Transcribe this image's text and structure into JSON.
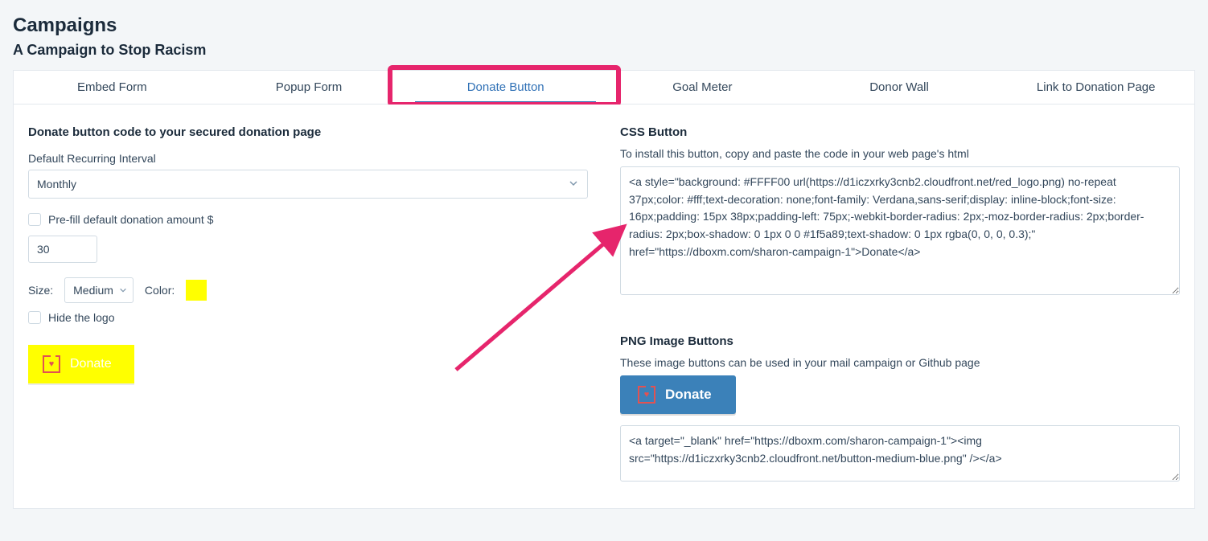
{
  "header": {
    "title": "Campaigns",
    "subtitle": "A Campaign to Stop Racism"
  },
  "tabs": [
    {
      "label": "Embed Form"
    },
    {
      "label": "Popup Form"
    },
    {
      "label": "Donate Button"
    },
    {
      "label": "Goal Meter"
    },
    {
      "label": "Donor Wall"
    },
    {
      "label": "Link to Donation Page"
    }
  ],
  "left": {
    "heading": "Donate button code to your secured donation page",
    "interval_label": "Default Recurring Interval",
    "interval_value": "Monthly",
    "prefill_label": "Pre-fill default donation amount $",
    "amount_value": "30",
    "size_label": "Size:",
    "size_value": "Medium",
    "color_label": "Color:",
    "color_value": "#FFFF00",
    "hide_logo_label": "Hide the logo",
    "donate_label": "Donate"
  },
  "right": {
    "css_heading": "CSS Button",
    "css_helper": "To install this button, copy and paste the code in your web page's html",
    "css_code": "<a style=\"background: #FFFF00 url(https://d1iczxrky3cnb2.cloudfront.net/red_logo.png) no-repeat 37px;color: #fff;text-decoration: none;font-family: Verdana,sans-serif;display: inline-block;font-size: 16px;padding: 15px 38px;padding-left: 75px;-webkit-border-radius: 2px;-moz-border-radius: 2px;border-radius: 2px;box-shadow: 0 1px 0 0 #1f5a89;text-shadow: 0 1px rgba(0, 0, 0, 0.3);\" href=\"https://dboxm.com/sharon-campaign-1\">Donate</a>",
    "png_heading": "PNG Image Buttons",
    "png_helper": "These image buttons can be used in your mail campaign or Github page",
    "png_donate_label": "Donate",
    "png_code": "<a target=\"_blank\" href=\"https://dboxm.com/sharon-campaign-1\"><img src=\"https://d1iczxrky3cnb2.cloudfront.net/button-medium-blue.png\" /></a>"
  }
}
